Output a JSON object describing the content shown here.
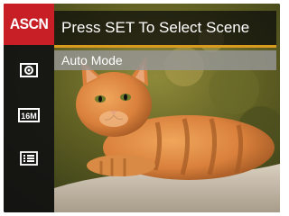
{
  "header": {
    "title": "Press SET To Select Scene"
  },
  "sidebar": {
    "items": [
      {
        "label": "ASCN",
        "icon": "scene-mode-icon",
        "active": true
      },
      {
        "icon": "metering-icon"
      },
      {
        "label": "16M",
        "icon": "image-size-icon"
      },
      {
        "icon": "menu-list-icon"
      }
    ]
  },
  "selection": {
    "mode": "Auto Mode"
  },
  "colors": {
    "accent": "#c71f25",
    "underline": "#d99b1f"
  }
}
